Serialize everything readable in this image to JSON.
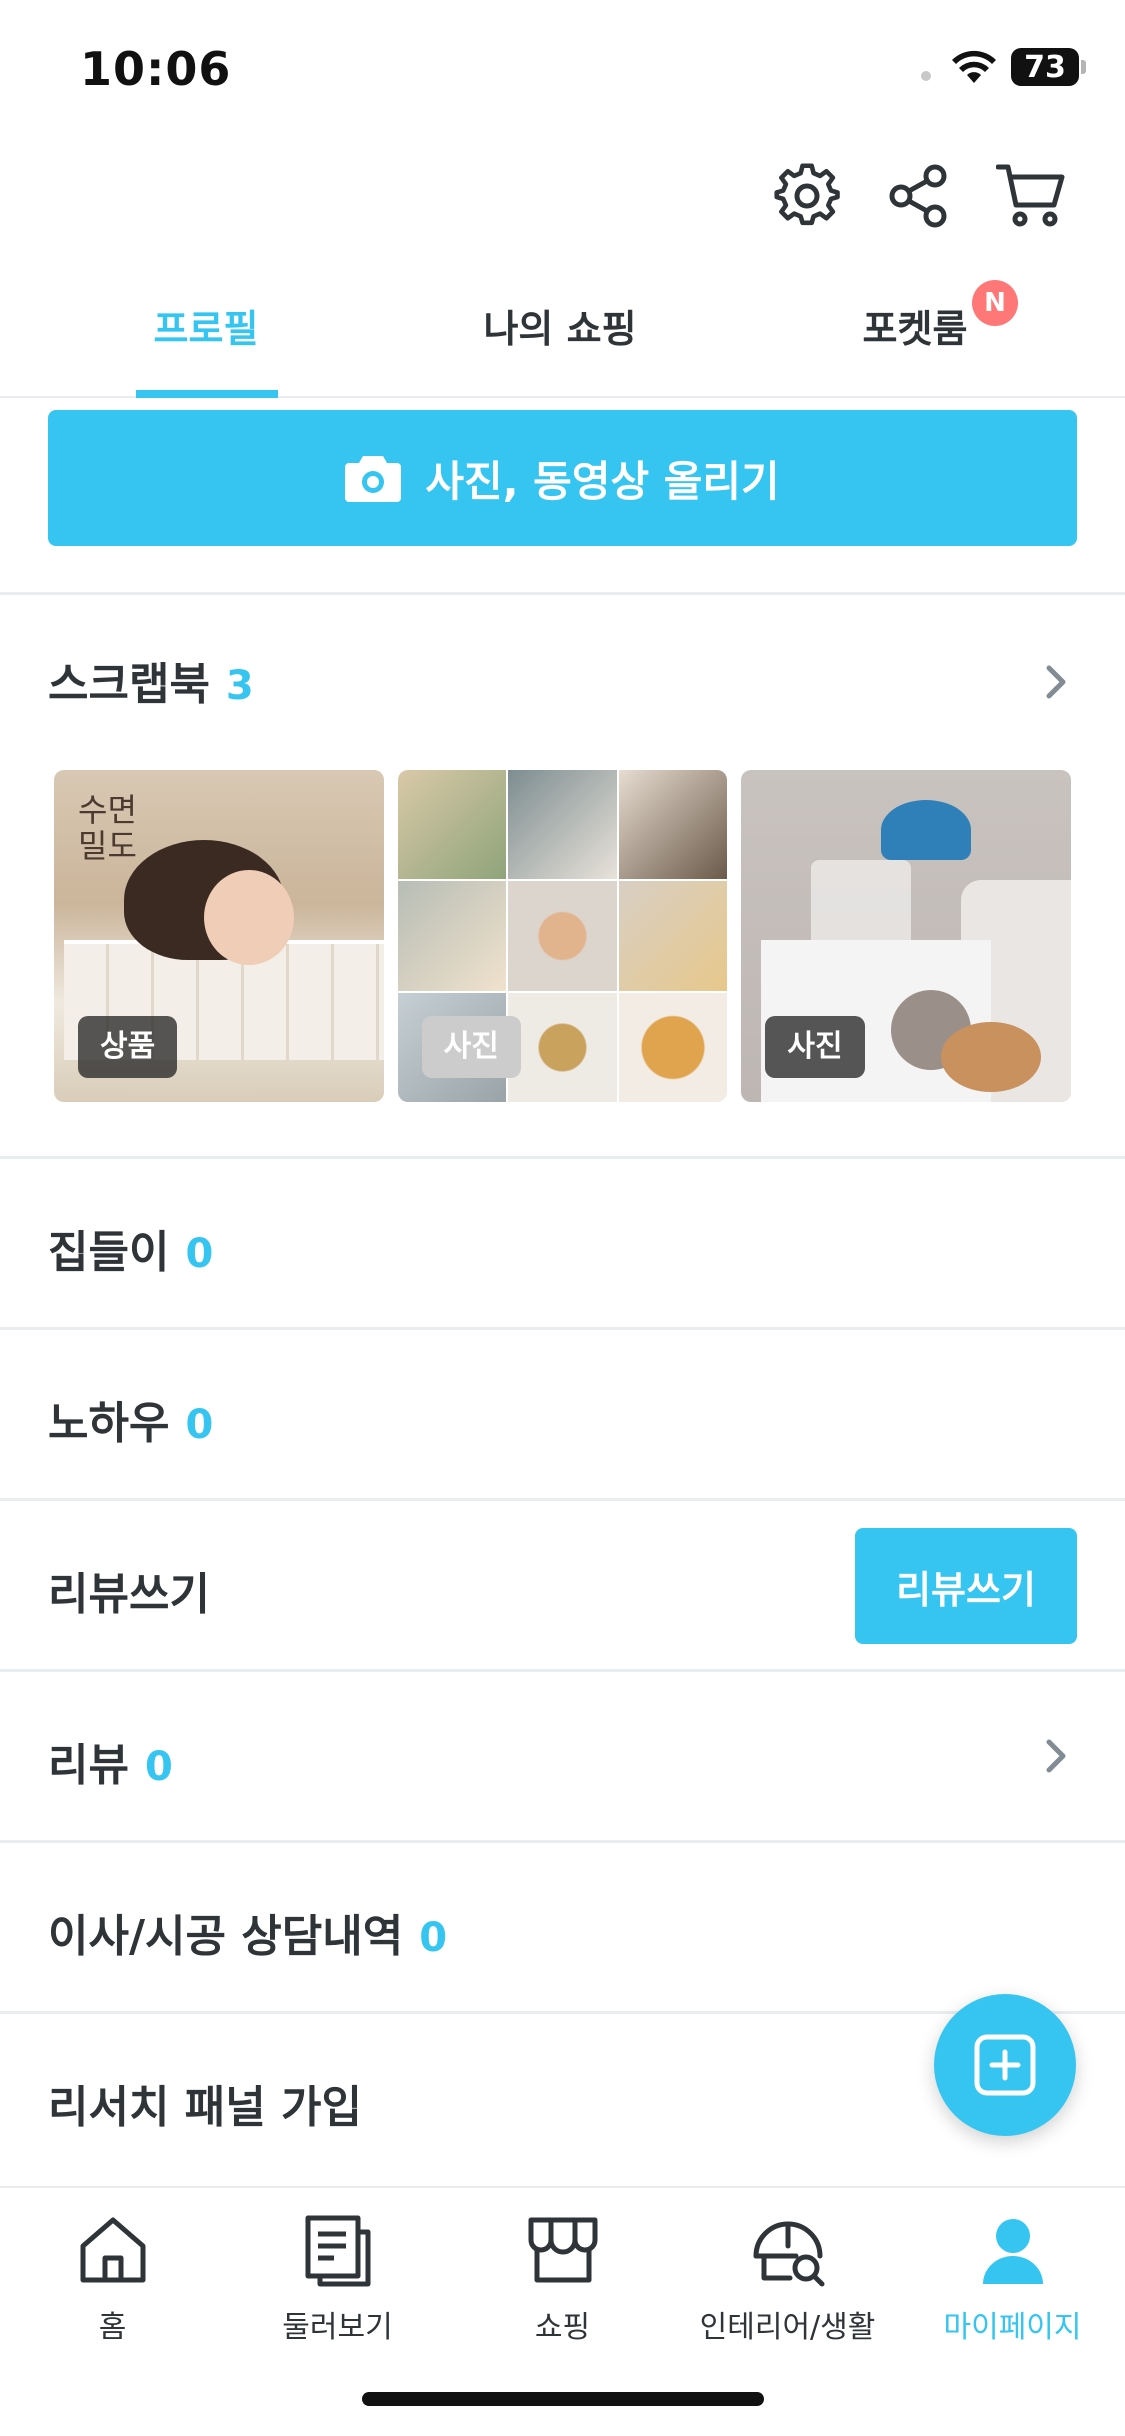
{
  "status_bar": {
    "time": "10:06",
    "battery": "73"
  },
  "header": {
    "icons": [
      "gear-icon",
      "share-icon",
      "cart-icon"
    ]
  },
  "tabs": [
    {
      "label": "프로필",
      "active": true
    },
    {
      "label": "나의 쇼핑",
      "active": false
    },
    {
      "label": "포켓룸",
      "active": false,
      "badge": "N"
    }
  ],
  "upload_button": {
    "label": "사진, 동영상 올리기",
    "icon": "camera-icon"
  },
  "scrapbook": {
    "title": "스크랩북",
    "count": "3",
    "items": [
      {
        "label": "상품",
        "brand_text": "수면\n밀도"
      },
      {
        "label": "사진"
      },
      {
        "label": "사진"
      }
    ]
  },
  "sections": {
    "housewarming": {
      "title": "집들이",
      "count": "0"
    },
    "knowhow": {
      "title": "노하우",
      "count": "0"
    },
    "write_review": {
      "title": "리뷰쓰기",
      "button_label": "리뷰쓰기"
    },
    "review": {
      "title": "리뷰",
      "count": "0"
    },
    "moving": {
      "title": "이사/시공 상담내역",
      "count": "0"
    },
    "research": {
      "title": "리서치 패널 가입"
    }
  },
  "bottom_nav": [
    {
      "label": "홈",
      "icon": "home-icon",
      "active": false
    },
    {
      "label": "둘러보기",
      "icon": "browse-icon",
      "active": false
    },
    {
      "label": "쇼핑",
      "icon": "store-icon",
      "active": false
    },
    {
      "label": "인테리어/생활",
      "icon": "interior-icon",
      "active": false
    },
    {
      "label": "마이페이지",
      "icon": "person-icon",
      "active": true
    }
  ],
  "colors": {
    "accent": "#35c5f0",
    "text": "#2f3438",
    "badge": "#ff7777",
    "divider": "#eaedef"
  }
}
